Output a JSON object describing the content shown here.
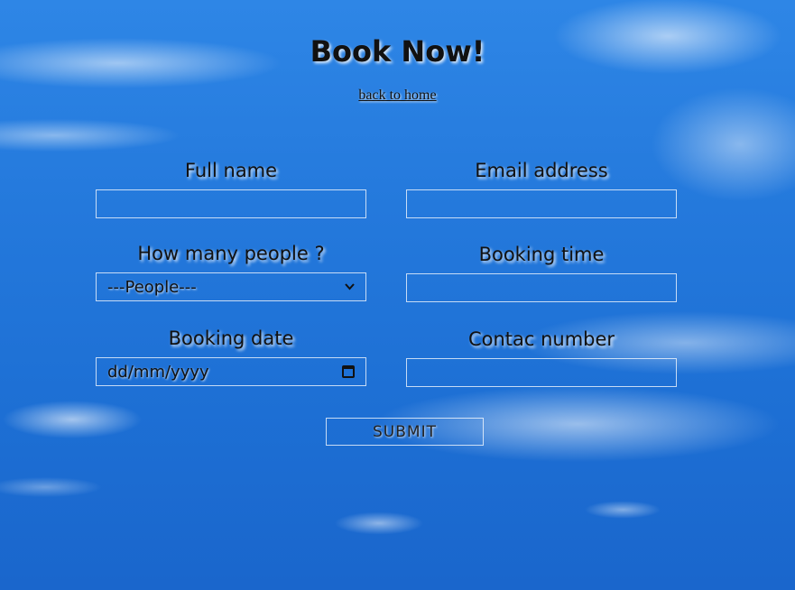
{
  "page": {
    "title": "Book Now!",
    "back_link": "back to home"
  },
  "form": {
    "full_name": {
      "label": "Full name",
      "value": ""
    },
    "email": {
      "label": "Email address",
      "value": ""
    },
    "people": {
      "label": "How many people ?",
      "selected": "---People---"
    },
    "booking_time": {
      "label": "Booking time",
      "value": ""
    },
    "booking_date": {
      "label": "Booking date",
      "placeholder": "dd/mm/yyyy"
    },
    "contact_number": {
      "label": "Contac number",
      "value": ""
    },
    "submit_label": "SUBMIT"
  },
  "icons": {
    "select": "chevron-down-icon",
    "date": "calendar-icon"
  }
}
